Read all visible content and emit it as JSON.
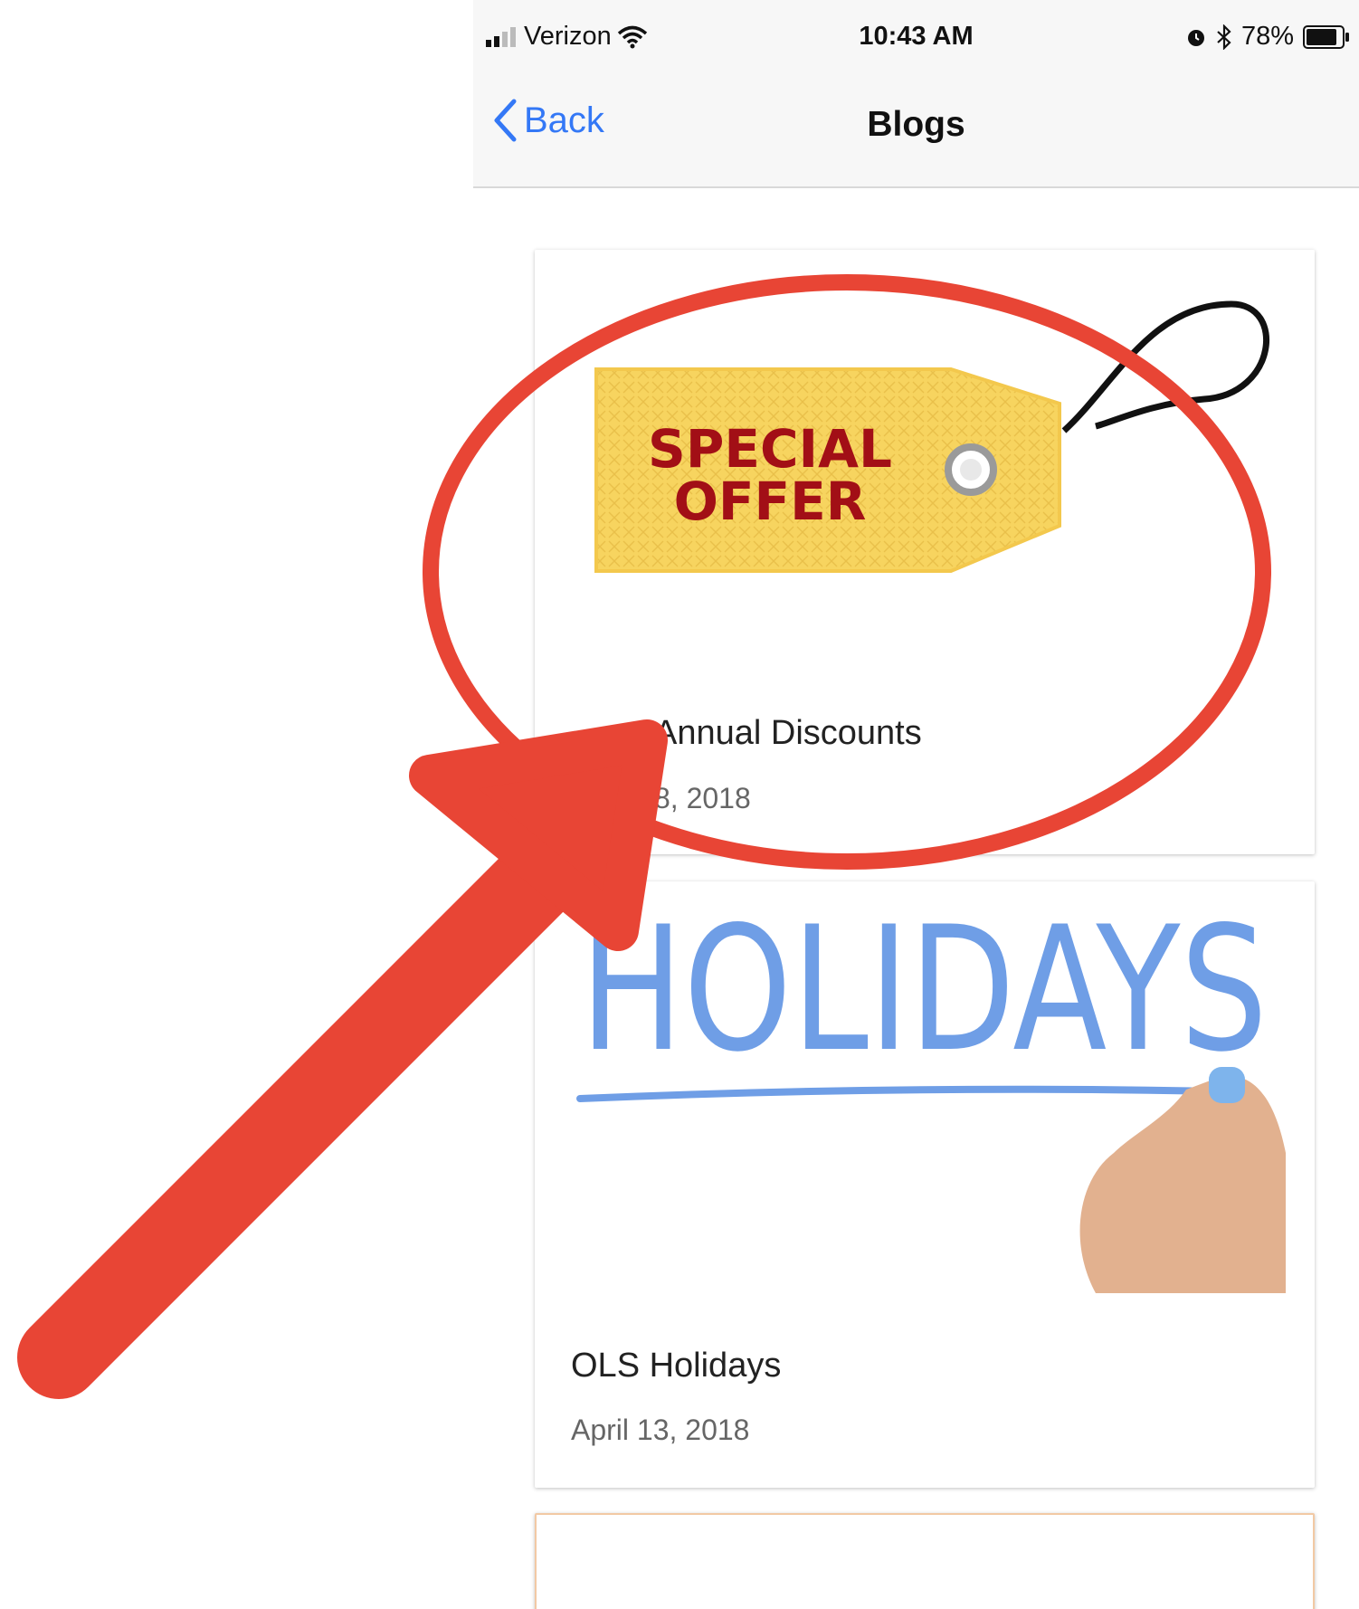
{
  "status_bar": {
    "carrier": "Verizon",
    "time": "10:43 AM",
    "battery": "78%"
  },
  "nav": {
    "back_label": "Back",
    "title": "Blogs"
  },
  "cards": [
    {
      "image_text": [
        "SPECIAL",
        "OFFER"
      ],
      "title": "Annual Discounts",
      "date": "8, 2018"
    },
    {
      "image_text": "HOLIDAYS",
      "title": "OLS Holidays",
      "date": "April 13, 2018"
    }
  ],
  "colors": {
    "ios_blue": "#3478f6",
    "annotation_red": "#e84535",
    "tag_yellow": "#f7d45f",
    "tag_text": "#a20f16",
    "holiday_blue": "#6f9ee6"
  }
}
